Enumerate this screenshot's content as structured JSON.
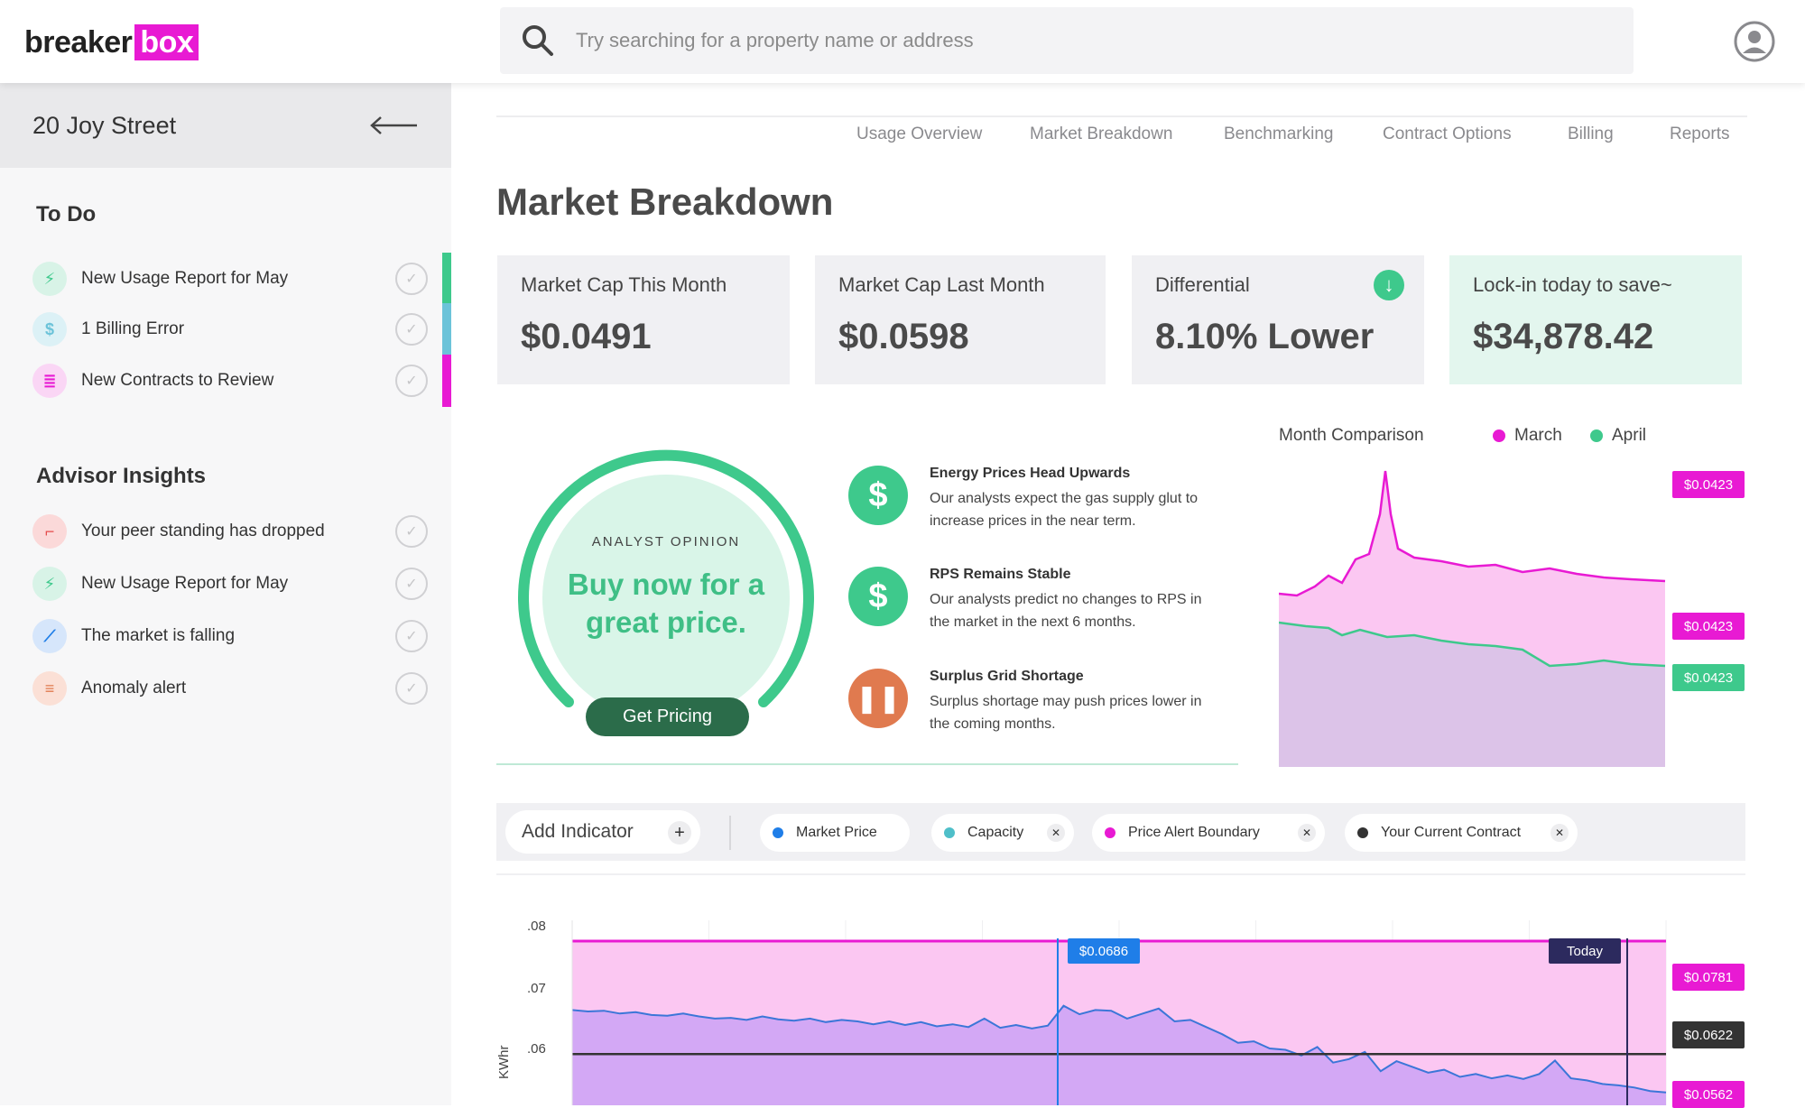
{
  "app": {
    "logo_part1": "breaker",
    "logo_part2": "box",
    "search_placeholder": "Try searching for a property name or address",
    "accent": "#e81ad3"
  },
  "sidebar": {
    "property": "20 Joy Street",
    "todo_title": "To Do",
    "todo": [
      {
        "label": "New Usage Report for May",
        "icon": "lightning-icon",
        "color": "#3ec98c"
      },
      {
        "label": "1 Billing Error",
        "icon": "dollar-icon",
        "color": "#6cc3d9"
      },
      {
        "label": "New Contracts to Review",
        "icon": "document-icon",
        "color": "#e81ad3"
      }
    ],
    "insights_title": "Advisor Insights",
    "insights": [
      {
        "label": "Your peer standing has dropped",
        "icon": "step-down-icon"
      },
      {
        "label": "New Usage Report for May",
        "icon": "lightning-icon"
      },
      {
        "label": "The market is falling",
        "icon": "line-chart-icon"
      },
      {
        "label": "Anomaly alert",
        "icon": "alert-lines-icon"
      }
    ]
  },
  "tabs": [
    "Usage Overview",
    "Market Breakdown",
    "Benchmarking",
    "Contract Options",
    "Billing",
    "Reports"
  ],
  "page_title": "Market Breakdown",
  "cards": [
    {
      "title": "Market Cap This Month",
      "value": "$0.0491"
    },
    {
      "title": "Market Cap Last Month",
      "value": "$0.0598"
    },
    {
      "title": "Differential",
      "value": "8.10% Lower"
    },
    {
      "title": "Lock-in today to save~",
      "value": "$34,878.42"
    }
  ],
  "analyst": {
    "label": "ANALYST OPINION",
    "headline": "Buy now for a great price.",
    "button": "Get Pricing"
  },
  "insights": [
    {
      "title": "Energy Prices Head Upwards",
      "desc": "Our analysts expect the gas supply glut to increase prices in the near term.",
      "icon": "dollar-icon"
    },
    {
      "title": "RPS Remains Stable",
      "desc": "Our analysts predict no changes to RPS in the market in the next 6 months.",
      "icon": "dollar-icon"
    },
    {
      "title": "Surplus Grid Shortage",
      "desc": "Surplus shortage may push prices lower in the coming months.",
      "icon": "pause-icon"
    }
  ],
  "month_comparison": {
    "title": "Month Comparison",
    "legend": [
      {
        "name": "March",
        "color": "#e81ad3"
      },
      {
        "name": "April",
        "color": "#3ec98c"
      }
    ],
    "tags": [
      "$0.0423",
      "$0.0423",
      "$0.0423"
    ]
  },
  "indicators": {
    "add_label": "Add Indicator",
    "chips": [
      {
        "label": "Market Price",
        "color": "#1f7ee8",
        "removable": false
      },
      {
        "label": "Capacity",
        "color": "#4fbfc9",
        "removable": true
      },
      {
        "label": "Price Alert Boundary",
        "color": "#e81ad3",
        "removable": true
      },
      {
        "label": "Your Current Contract",
        "color": "#333333",
        "removable": true
      }
    ]
  },
  "chart_data": {
    "type": "area",
    "y_ticks": [
      ".08",
      ".07",
      ".06"
    ],
    "ylabel": "KWhr",
    "ylim": [
      0.055,
      0.08
    ],
    "marker_label": "$0.0686",
    "today_label": "Today",
    "alert_boundary": 0.0781,
    "current_contract": 0.0622,
    "floor": 0.0562,
    "right_tags": [
      "$0.0781",
      "$0.0622",
      "$0.0562"
    ],
    "market_price": [
      0.0684,
      0.0682,
      0.0683,
      0.0679,
      0.0681,
      0.0677,
      0.0676,
      0.0679,
      0.0675,
      0.0672,
      0.0673,
      0.067,
      0.0675,
      0.0671,
      0.0669,
      0.0672,
      0.0667,
      0.067,
      0.0668,
      0.0664,
      0.0668,
      0.0663,
      0.0667,
      0.0661,
      0.0664,
      0.066,
      0.0672,
      0.0659,
      0.0663,
      0.0658,
      0.0662,
      0.069,
      0.0678,
      0.0684,
      0.0683,
      0.0672,
      0.0679,
      0.0686,
      0.0668,
      0.067,
      0.066,
      0.065,
      0.0638,
      0.064,
      0.063,
      0.0628,
      0.062,
      0.0632,
      0.061,
      0.0615,
      0.0625,
      0.0598,
      0.0612,
      0.0604,
      0.0596,
      0.06,
      0.059,
      0.0594,
      0.0588,
      0.0592,
      0.0587,
      0.0594,
      0.0613,
      0.0588,
      0.0585,
      0.058,
      0.0578,
      0.0575,
      0.057,
      0.0568
    ]
  }
}
